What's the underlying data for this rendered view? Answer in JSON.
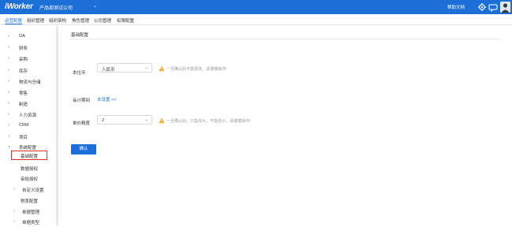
{
  "header": {
    "logo": "iWorker",
    "company": "产品部测试公司",
    "help": "帮助文档",
    "icons": [
      "gear-icon",
      "chat-icon",
      "avatar"
    ]
  },
  "nav": {
    "tabs": [
      {
        "label": "运营配置",
        "active": true
      },
      {
        "label": "组织管理",
        "active": false
      },
      {
        "label": "组织架构",
        "active": false
      },
      {
        "label": "角色管理",
        "active": false
      },
      {
        "label": "公司管理",
        "active": false
      },
      {
        "label": "权限配置",
        "active": false
      }
    ]
  },
  "sidebar": {
    "items": [
      {
        "label": "OA"
      },
      {
        "label": "财务"
      },
      {
        "label": "采购"
      },
      {
        "label": "库存"
      },
      {
        "label": "物流与仓储"
      },
      {
        "label": "零售"
      },
      {
        "label": "制造"
      },
      {
        "label": "人力资源"
      },
      {
        "label": "CRM"
      },
      {
        "label": "项目"
      },
      {
        "label": "系统配置"
      },
      {
        "label": "基础配置"
      },
      {
        "label": "数据授权"
      },
      {
        "label": "审批授权"
      },
      {
        "label": "自定义设置"
      },
      {
        "label": "税率配置"
      },
      {
        "label": "单据管理"
      },
      {
        "label": "单据类型"
      }
    ]
  },
  "main": {
    "section_title": "基础配置",
    "fields": [
      {
        "label": "本位币",
        "value": "人民币",
        "warning": "一旦确认后不能更改，请谨慎操作!"
      },
      {
        "label": "会计期间",
        "link": "去设置 >>"
      },
      {
        "label": "单价精度",
        "value": "2",
        "warning": "一旦确认后，只能改大，不能改小，请谨慎操作!"
      }
    ],
    "confirm_label": "确认"
  },
  "colors": {
    "primary": "#1c6fd6",
    "warning": "#f5a623",
    "highlight_border": "#e02b2b"
  }
}
